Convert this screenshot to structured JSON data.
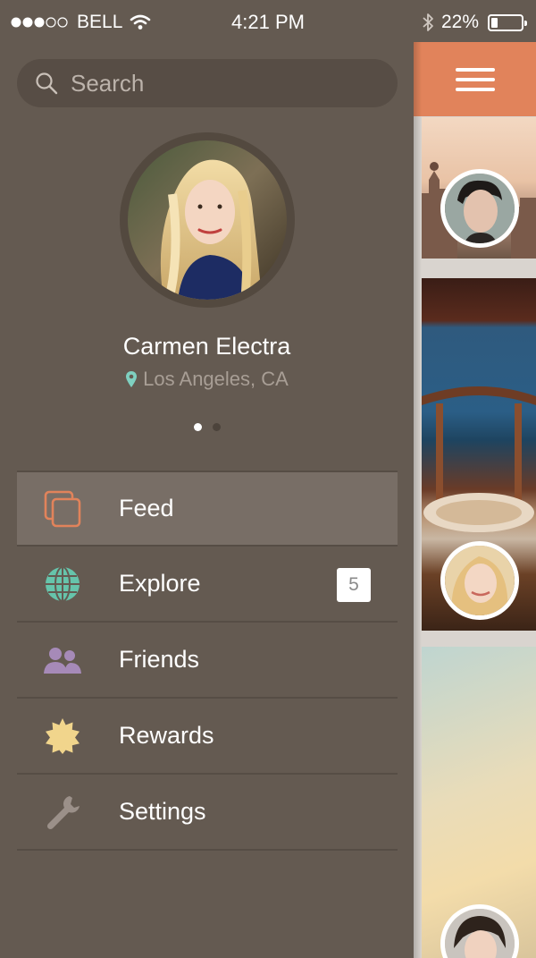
{
  "status_bar": {
    "carrier": "BELL",
    "signal_dots": 5,
    "signal_filled": 3,
    "time": "4:21 PM",
    "battery_percent": "22%",
    "battery_level": 0.22
  },
  "search": {
    "placeholder": "Search"
  },
  "profile": {
    "name": "Carmen Electra",
    "location": "Los Angeles, CA",
    "page_count": 2,
    "active_page": 1
  },
  "menu": {
    "items": [
      {
        "label": "Feed",
        "icon": "feed-icon",
        "active": true
      },
      {
        "label": "Explore",
        "icon": "globe-icon",
        "badge": "5"
      },
      {
        "label": "Friends",
        "icon": "friends-icon"
      },
      {
        "label": "Rewards",
        "icon": "rewards-badge-icon"
      },
      {
        "label": "Settings",
        "icon": "wrench-icon"
      }
    ]
  },
  "colors": {
    "drawer_bg": "#645a51",
    "accent": "#e1835b",
    "feed_icon": "#e1835b",
    "explore_icon": "#66c4ab",
    "friends_icon": "#a68ab8",
    "rewards_icon": "#f1d58c",
    "settings_icon": "#9b9089",
    "location_pin": "#7fd0c0"
  }
}
